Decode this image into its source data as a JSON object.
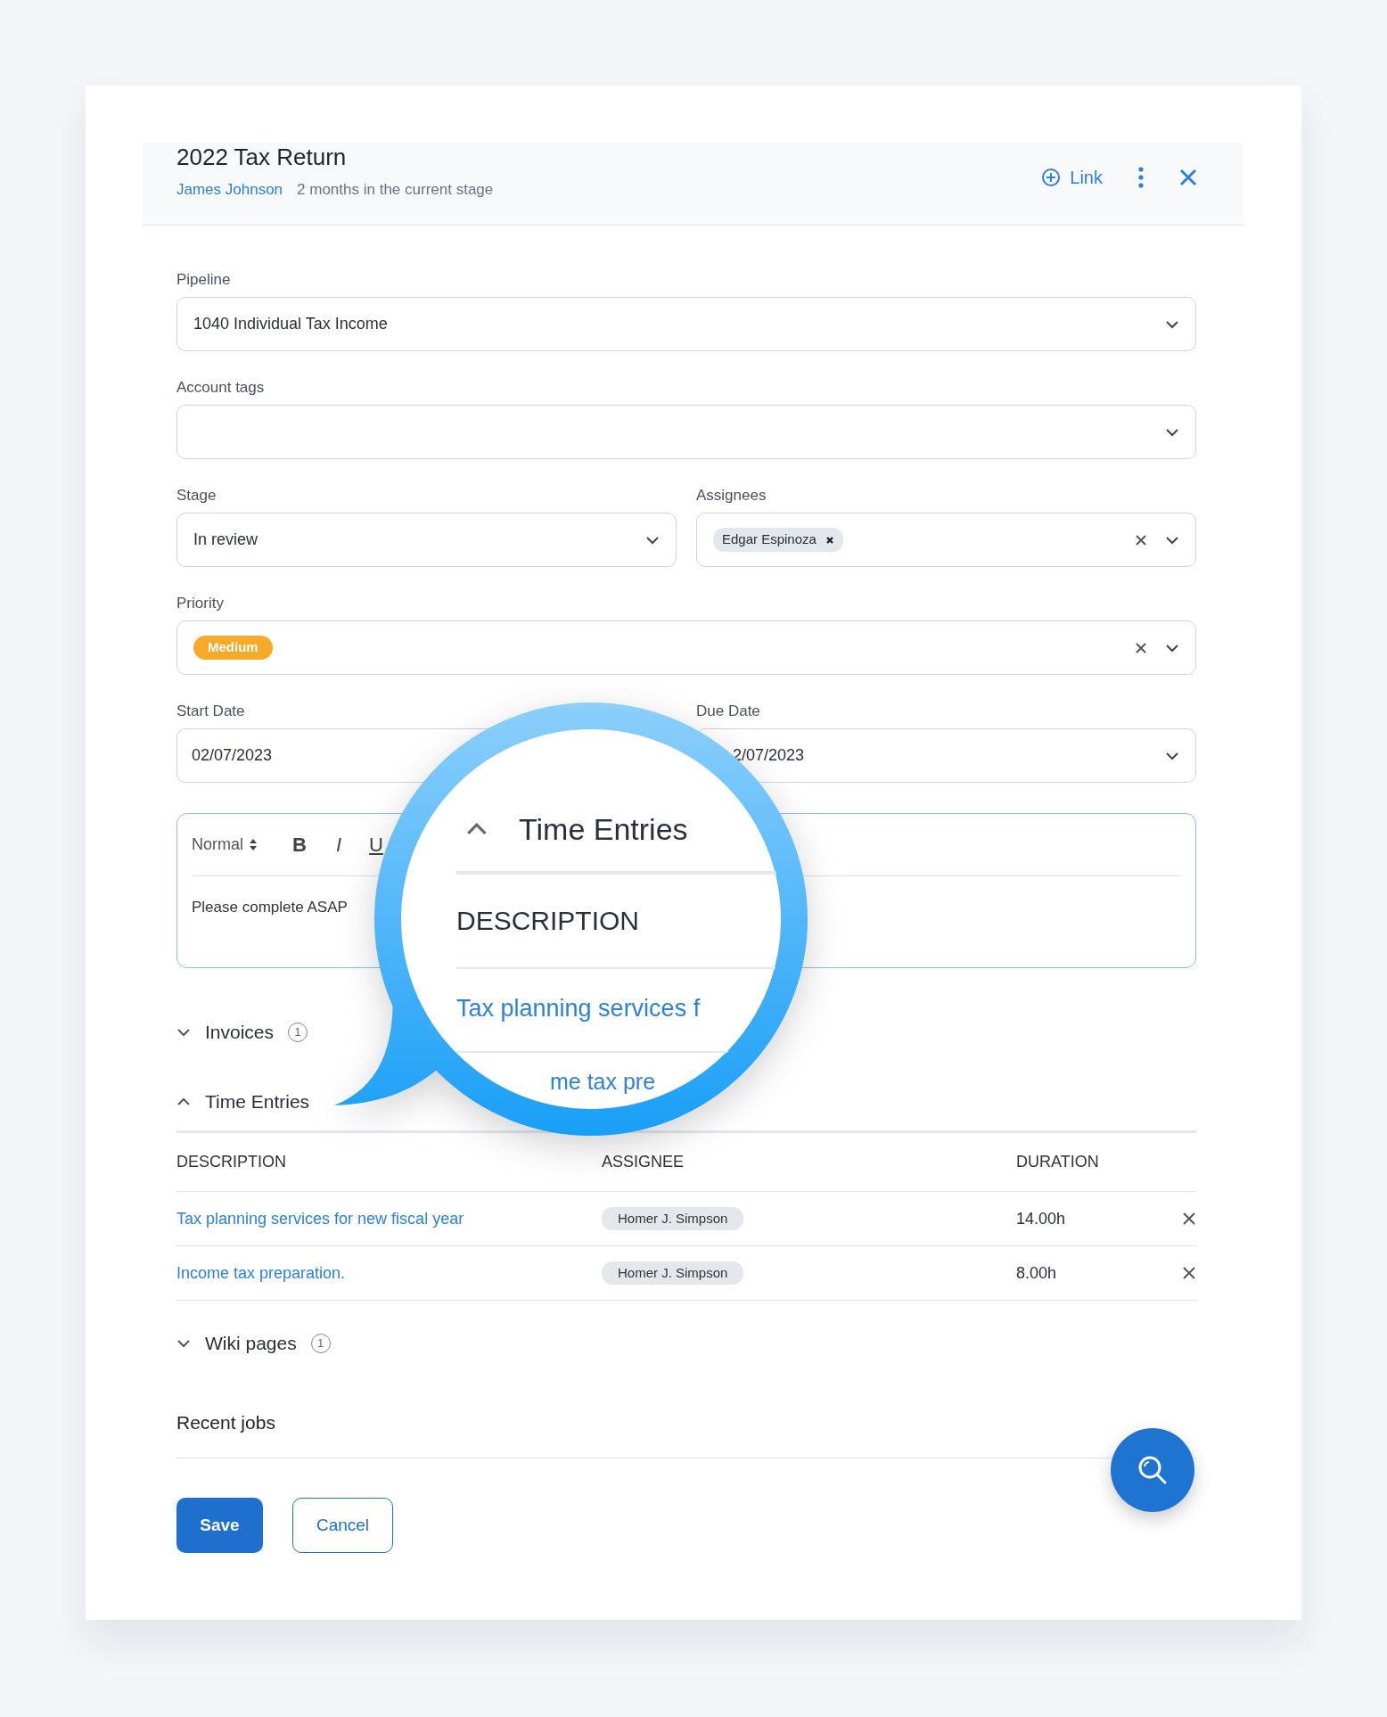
{
  "header": {
    "title": "2022 Tax Return",
    "client": "James Johnson",
    "stage_age": "2 months in the current stage",
    "link_button": "Link"
  },
  "pipeline": {
    "label": "Pipeline",
    "value": "1040 Individual Tax Income"
  },
  "account_tags": {
    "label": "Account tags"
  },
  "stage": {
    "label": "Stage",
    "value": "In review"
  },
  "assignees": {
    "label": "Assignees",
    "chips": [
      "Edgar Espinoza"
    ]
  },
  "priority": {
    "label": "Priority",
    "chip": {
      "text": "Medium",
      "color": "#f7a928"
    }
  },
  "start_date": {
    "label": "Start Date",
    "value": "02/07/2023"
  },
  "due_date": {
    "label": "Due Date",
    "value": "2/07/2023"
  },
  "editor": {
    "format": "Normal",
    "tools": [
      {
        "kind": "bold",
        "label": "B"
      },
      {
        "kind": "italic",
        "label": "I"
      },
      {
        "kind": "underline",
        "label": "U"
      }
    ],
    "text": "Please complete ASAP"
  },
  "sections": [
    {
      "title": "Invoices",
      "count": "1",
      "expanded": false
    },
    {
      "title": "Time Entries",
      "expanded": true,
      "table": {
        "columns": [
          "DESCRIPTION",
          "ASSIGNEE",
          "DURATION"
        ],
        "rows": [
          {
            "description": "Tax planning services for new fiscal year",
            "assignee": "Homer J. Simpson",
            "duration": "14.00h"
          },
          {
            "description": "Income tax preparation.",
            "assignee": "Homer J. Simpson",
            "duration": "8.00h"
          }
        ]
      }
    },
    {
      "title": "Wiki pages",
      "count": "1",
      "expanded": false
    }
  ],
  "recent_jobs": {
    "title": "Recent jobs"
  },
  "buttons": {
    "save": "Save",
    "cancel": "Cancel"
  },
  "magnifier": {
    "heading": "Time Entries",
    "column": "DESCRIPTION",
    "rows": [
      "Tax planning services f",
      "me tax pre"
    ]
  }
}
